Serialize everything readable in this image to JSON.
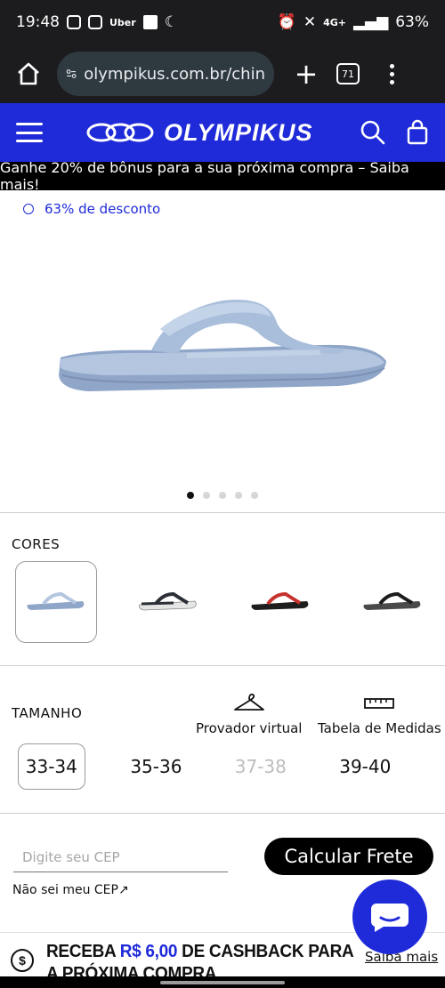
{
  "status_bar": {
    "time": "19:48",
    "carrier_icons": [
      "instagram-icon",
      "instagram-icon",
      "uber-icon",
      "data-icon",
      "moon-icon"
    ],
    "uber_text": "Uber",
    "network": "4G+",
    "battery": "63%"
  },
  "browser": {
    "url": "olympikus.com.br/chin",
    "tab_count": "71"
  },
  "header": {
    "brand": "OLYMPIKUS",
    "brand_color": "#1f2bd8"
  },
  "promo": {
    "text": "Ganhe 20% de bônus para a sua próxima compra – Saiba mais!"
  },
  "product": {
    "discount": "63% de desconto",
    "image_count": 5,
    "active_image": 1
  },
  "colors": {
    "title": "CORES",
    "options": [
      {
        "name": "light-blue",
        "sole": "#8fa6c9",
        "strap": "#b4c6df",
        "selected": true
      },
      {
        "name": "black-white",
        "sole": "#e5e5e5",
        "strap": "#2b2f36",
        "selected": false
      },
      {
        "name": "black-red",
        "sole": "#1e1e1e",
        "strap": "#c6322e",
        "selected": false
      },
      {
        "name": "black-grey",
        "sole": "#4a4a4a",
        "strap": "#1c1c1c",
        "selected": false
      }
    ]
  },
  "size": {
    "title": "TAMANHO",
    "virtual_label": "Provador virtual",
    "table_label": "Tabela de Medidas",
    "options": [
      {
        "label": "33-34",
        "selected": true,
        "disabled": false
      },
      {
        "label": "35-36",
        "selected": false,
        "disabled": false
      },
      {
        "label": "37-38",
        "selected": false,
        "disabled": true
      },
      {
        "label": "39-40",
        "selected": false,
        "disabled": false
      }
    ]
  },
  "shipping": {
    "cep_placeholder": "Digite seu CEP",
    "button_label": "Calcular Frete",
    "no_cep_link": "Não sei meu CEP↗"
  },
  "cashback": {
    "text_before": "RECEBA ",
    "amount": "R$ 6,00",
    "text_after": " DE CASHBACK PARA A PRÓXIMA COMPRA",
    "link": "Saiba mais"
  }
}
